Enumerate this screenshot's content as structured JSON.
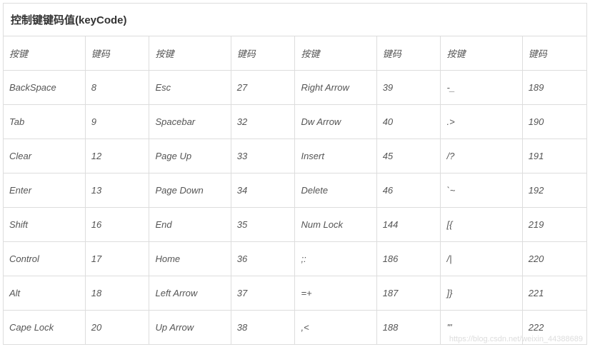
{
  "title": "控制键键码值(keyCode)",
  "headers": [
    "按键",
    "键码",
    "按键",
    "键码",
    "按键",
    "键码",
    "按键",
    "键码"
  ],
  "rows": [
    [
      "BackSpace",
      "8",
      "Esc",
      "27",
      "Right Arrow",
      "39",
      "-_",
      "189"
    ],
    [
      "Tab",
      "9",
      "Spacebar",
      "32",
      "Dw Arrow",
      "40",
      ".>",
      "190"
    ],
    [
      "Clear",
      "12",
      "Page Up",
      "33",
      "Insert",
      "45",
      "/?",
      "191"
    ],
    [
      "Enter",
      "13",
      "Page Down",
      "34",
      "Delete",
      "46",
      "`~",
      "192"
    ],
    [
      "Shift",
      "16",
      "End",
      "35",
      "Num Lock",
      "144",
      "[{",
      "219"
    ],
    [
      "Control",
      "17",
      "Home",
      "36",
      ";:",
      "186",
      "/|",
      "220"
    ],
    [
      "Alt",
      "18",
      "Left Arrow",
      "37",
      "=+",
      "187",
      "]}",
      "221"
    ],
    [
      "Cape Lock",
      "20",
      "Up Arrow",
      "38",
      ",<",
      "188",
      "'\"",
      "222"
    ]
  ],
  "watermark": "https://blog.csdn.net/weixin_44388689"
}
